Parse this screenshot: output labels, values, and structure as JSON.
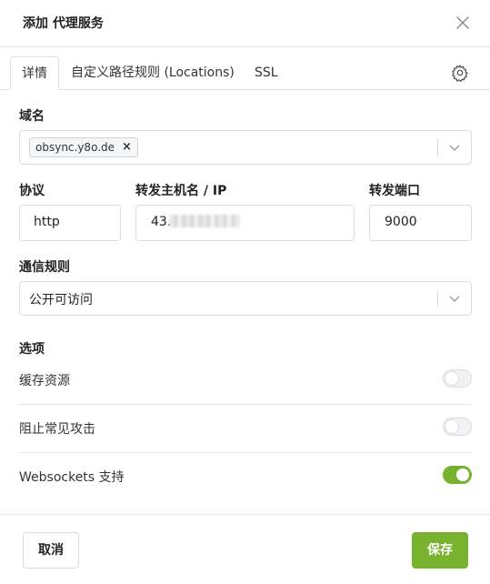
{
  "header": {
    "title": "添加 代理服务",
    "close_icon": "close-icon"
  },
  "tabs": [
    {
      "label": "详情",
      "active": true
    },
    {
      "label": "自定义路径规则 (Locations)",
      "active": false
    },
    {
      "label": "SSL",
      "active": false
    }
  ],
  "form": {
    "domain": {
      "label": "域名",
      "chips": [
        "obsync.y8o.de"
      ],
      "chip_remove": "×"
    },
    "scheme": {
      "label": "协议",
      "value": "http"
    },
    "forward_host": {
      "label": "转发主机名 / IP",
      "value_visible": "43."
    },
    "forward_port": {
      "label": "转发端口",
      "value": "9000"
    },
    "access": {
      "label": "通信规则",
      "value": "公开可访问"
    }
  },
  "options": {
    "title": "选项",
    "items": [
      {
        "label": "缓存资源",
        "enabled": false
      },
      {
        "label": "阻止常见攻击",
        "enabled": false
      },
      {
        "label": "Websockets 支持",
        "enabled": true
      }
    ]
  },
  "footer": {
    "cancel_label": "取消",
    "save_label": "保存"
  },
  "colors": {
    "accent": "#79b22f",
    "border": "#d9dde3"
  }
}
